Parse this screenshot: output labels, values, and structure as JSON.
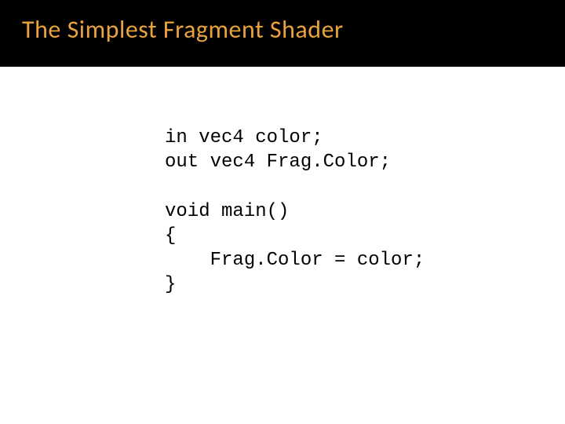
{
  "slide": {
    "title": "The Simplest Fragment Shader",
    "code": {
      "line1": "in vec4 color;",
      "line2": "out vec4 Frag.Color;",
      "line3": "",
      "line4": "void main()",
      "line5": "{",
      "line6": "    Frag.Color = color;",
      "line7": "}"
    }
  }
}
